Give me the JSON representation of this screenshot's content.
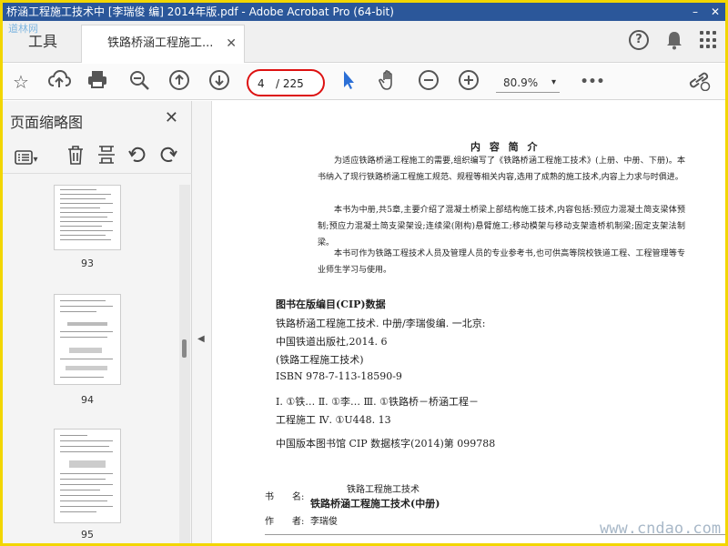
{
  "window": {
    "title": "桥涵工程施工技术中 [李瑞俊 编] 2014年版.pdf - Adobe Acrobat Pro (64-bit)",
    "min": "–",
    "close": "✕"
  },
  "tabs": {
    "tools": "工具",
    "doc": "铁路桥涵工程施工...",
    "close": "✕"
  },
  "toolbar": {
    "page_current": "4",
    "page_total": "/ 225",
    "zoom": "80.9%",
    "zoom_caret": "▾",
    "more": "•••"
  },
  "sidebar": {
    "title": "页面缩略图",
    "close": "✕",
    "options_caret": "▾",
    "thumbnails": [
      {
        "page": "93"
      },
      {
        "page": "94"
      },
      {
        "page": "95"
      }
    ]
  },
  "document": {
    "heading": "内 容 简 介",
    "paragraphs": [
      "为适应铁路桥涵工程施工的需要,组织编写了《铁路桥涵工程施工技术》(上册、中册、下册)。本书纳入了现行铁路桥涵工程施工规范、规程等相关内容,选用了成熟的施工技术,内容上力求与时俱进。",
      "本书为中册,共5章,主要介绍了混凝土桥梁上部结构施工技术,内容包括:预应力混凝土简支梁体预制;预应力混凝土简支梁架设;连续梁(刚构)悬臂施工;移动模架与移动支架造桥机制梁;固定支架法制梁。",
      "本书可作为铁路工程技术人员及管理人员的专业参考书,也可供高等院校铁道工程、工程管理等专业师生学习与使用。"
    ],
    "cip_heading": "图书在版编目(CIP)数据",
    "cip_lines": [
      "铁路桥涵工程施工技术. 中册/李瑞俊编. 一北京:",
      "中国铁道出版社,2014. 6",
      "(铁路工程施工技术)",
      "ISBN 978-7-113-18590-9",
      "Ⅰ. ①铁… Ⅱ. ①李… Ⅲ. ①铁路桥－桥涵工程－",
      "工程施工 Ⅳ. ①U448. 13",
      "中国版本图书馆 CIP 数据核字(2014)第 099788"
    ],
    "series_name": "铁路工程施工技术",
    "book_label": "书　　名:",
    "book_title": "铁路桥涵工程施工技术(中册)",
    "author_label": "作　　者:",
    "author": "李瑞俊"
  },
  "watermark": {
    "site": "www.cndao.com",
    "corner": "道林网"
  }
}
